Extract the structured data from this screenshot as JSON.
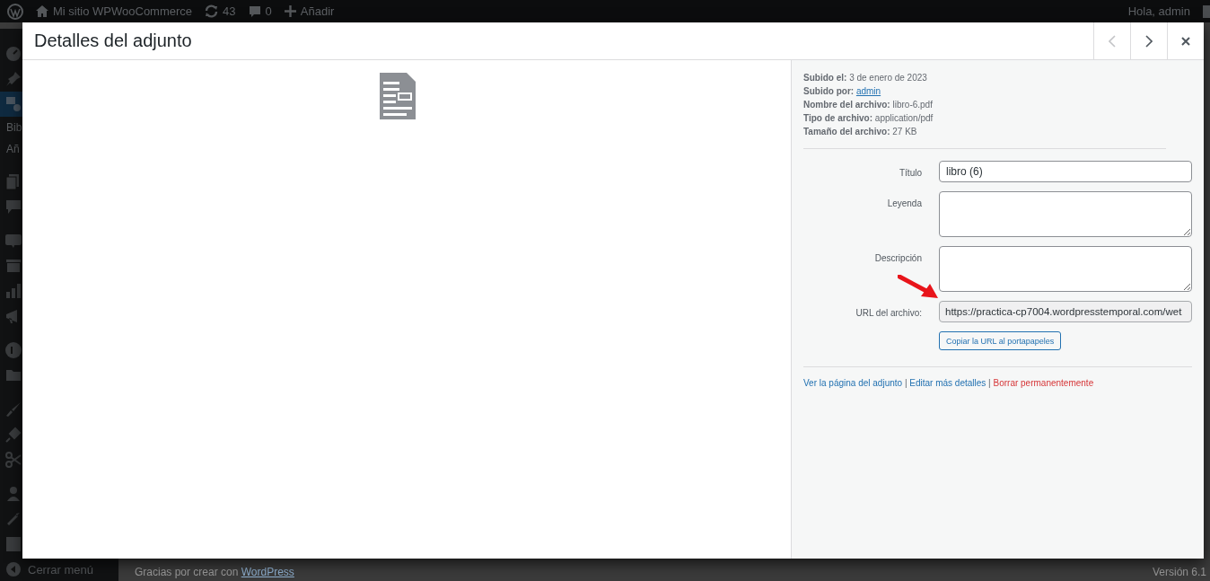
{
  "admin_bar": {
    "site_name": "Mi sitio WPWooCommerce",
    "updates": "43",
    "comments": "0",
    "new_label": "Añadir",
    "greeting": "Hola, admin"
  },
  "admin_menu": {
    "submenu": [
      "Bib",
      "Añ"
    ],
    "collapse_label": "Cerrar menú"
  },
  "footer": {
    "thanks": "Gracias por crear con ",
    "thanks_link": "WordPress",
    "version": "Versión 6.1"
  },
  "modal": {
    "title": "Detalles del adjunto",
    "nav": [
      {
        "kind": "previous",
        "disabled": true
      },
      {
        "kind": "next",
        "disabled": false
      }
    ],
    "meta": [
      {
        "label": "Subido el:",
        "value": "3 de enero de 2023",
        "link": false
      },
      {
        "label": "Subido por:",
        "value": "admin",
        "link": true
      },
      {
        "label": "Nombre del archivo:",
        "value": "libro-6.pdf",
        "link": false
      },
      {
        "label": "Tipo de archivo:",
        "value": "application/pdf",
        "link": false
      },
      {
        "label": "Tamaño del archivo:",
        "value": "27 KB",
        "link": false
      }
    ],
    "fields": [
      {
        "kind": "input",
        "label": "Título",
        "value": "libro (6)"
      },
      {
        "kind": "textarea",
        "label": "Leyenda"
      },
      {
        "kind": "textarea",
        "label": "Descripción"
      },
      {
        "kind": "readonly",
        "label": "URL del archivo:",
        "value": "https://practica-cp7004.wordpresstemporal.com/wet"
      }
    ],
    "link_separator": "|",
    "copy_button": "Copiar la URL al portapapeles",
    "links": [
      {
        "label": "Ver la página del adjunto",
        "kind": "normal"
      },
      {
        "label": "Editar más detalles",
        "kind": "normal"
      },
      {
        "label": "Borrar permanentemente",
        "kind": "delete"
      }
    ]
  }
}
